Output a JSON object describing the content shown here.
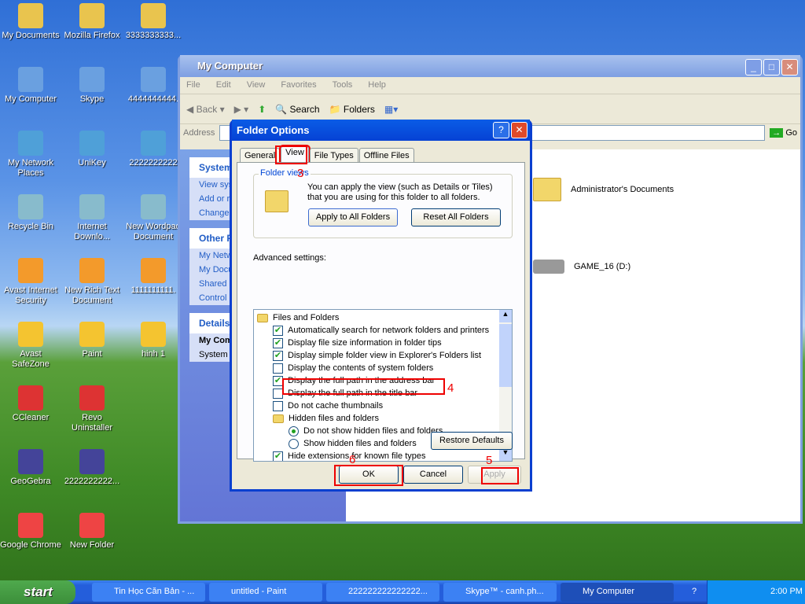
{
  "desktop": {
    "icons": [
      [
        "My Documents",
        "My Computer",
        "My Network Places",
        "Recycle Bin",
        "Avast Internet Security",
        "Avast SafeZone",
        "CCleaner",
        "GeoGebra",
        "Google Chrome"
      ],
      [
        "Mozilla Firefox",
        "Skype",
        "UniKey",
        "Internet Downlo...",
        "New Rich Text Document",
        "Paint",
        "Revo Uninstaller",
        "2222222222...",
        "New Folder"
      ],
      [
        "3333333333...",
        "4444444444.",
        "2222222222",
        "New Wordpad Document",
        "1111111111.",
        "hinh 1"
      ]
    ]
  },
  "explorer": {
    "title": "My Computer",
    "menu": [
      "File",
      "Edit",
      "View",
      "Favorites",
      "Tools",
      "Help"
    ],
    "toolbar": {
      "back": "Back",
      "search": "Search",
      "folders": "Folders"
    },
    "address_label": "Address",
    "go": "Go",
    "panels": [
      {
        "title": "System Tasks",
        "items": [
          "View system information",
          "Add or remove programs",
          "Change a setting"
        ]
      },
      {
        "title": "Other Places",
        "items": [
          "My Network Places",
          "My Documents",
          "Shared Documents",
          "Control Panel"
        ]
      },
      {
        "title": "Details",
        "items": [
          "My Computer",
          "System Folder"
        ]
      }
    ],
    "items": [
      "Administrator's Documents",
      "GAME_16 (D:)"
    ]
  },
  "dialog": {
    "title": "Folder Options",
    "tabs": [
      "General",
      "View",
      "File Types",
      "Offline Files"
    ],
    "active_tab": "View",
    "folder_views": {
      "legend": "Folder views",
      "text": "You can apply the view (such as Details or Tiles) that you are using for this folder to all folders.",
      "apply_all": "Apply to All Folders",
      "reset_all": "Reset All Folders"
    },
    "advanced_label": "Advanced settings:",
    "settings": [
      {
        "type": "folder",
        "label": "Files and Folders"
      },
      {
        "type": "check",
        "label": "Automatically search for network folders and printers",
        "checked": true
      },
      {
        "type": "check",
        "label": "Display file size information in folder tips",
        "checked": true
      },
      {
        "type": "check",
        "label": "Display simple folder view in Explorer's Folders list",
        "checked": true
      },
      {
        "type": "check",
        "label": "Display the contents of system folders",
        "checked": false
      },
      {
        "type": "check",
        "label": "Display the full path in the address bar",
        "checked": true
      },
      {
        "type": "check",
        "label": "Display the full path in the title bar",
        "checked": false
      },
      {
        "type": "check",
        "label": "Do not cache thumbnails",
        "checked": false
      },
      {
        "type": "folder2",
        "label": "Hidden files and folders"
      },
      {
        "type": "radio",
        "label": "Do not show hidden files and folders",
        "checked": true
      },
      {
        "type": "radio",
        "label": "Show hidden files and folders",
        "checked": false
      },
      {
        "type": "check",
        "label": "Hide extensions for known file types",
        "checked": true
      }
    ],
    "restore": "Restore Defaults",
    "ok": "OK",
    "cancel": "Cancel",
    "apply": "Apply"
  },
  "annotations": {
    "n3": "3",
    "n4": "4",
    "n5": "5",
    "n6": "6"
  },
  "taskbar": {
    "start": "start",
    "items": [
      "Tin Học Căn Bản - ...",
      "untitled - Paint",
      "222222222222222...",
      "Skype™ - canh.ph...",
      "My Computer"
    ],
    "active": "My Computer",
    "clock": "2:00 PM"
  }
}
